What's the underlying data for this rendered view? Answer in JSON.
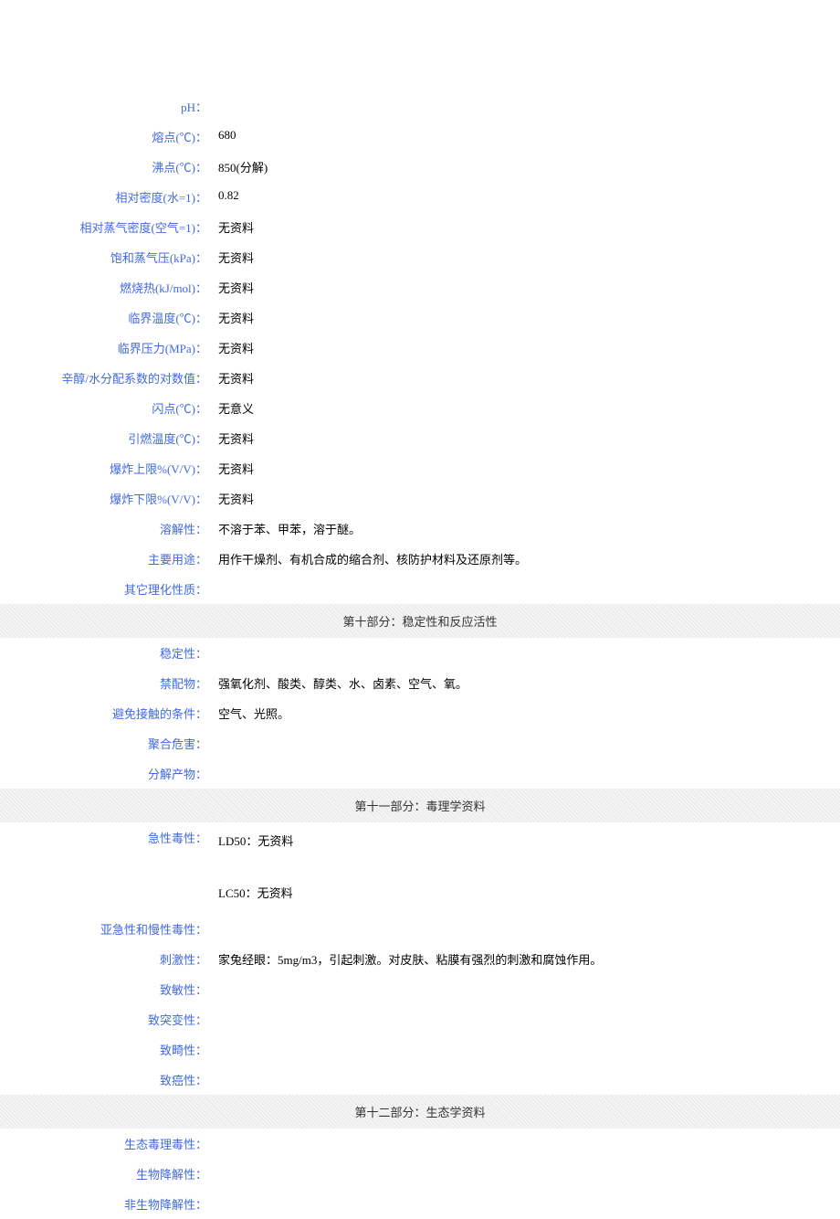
{
  "props": [
    {
      "label": "pH：",
      "value": ""
    },
    {
      "label": "熔点(℃)：",
      "value": "680"
    },
    {
      "label": "沸点(℃)：",
      "value": "850(分解)"
    },
    {
      "label": "相对密度(水=1)：",
      "value": "0.82"
    },
    {
      "label": "相对蒸气密度(空气=1)：",
      "value": "无资料"
    },
    {
      "label": "饱和蒸气压(kPa)：",
      "value": "无资料"
    },
    {
      "label": "燃烧热(kJ/mol)：",
      "value": "无资料"
    },
    {
      "label": "临界温度(℃)：",
      "value": "无资料"
    },
    {
      "label": "临界压力(MPa)：",
      "value": "无资料"
    },
    {
      "label": "辛醇/水分配系数的对数值：",
      "value": "无资料"
    },
    {
      "label": "闪点(℃)：",
      "value": "无意义"
    },
    {
      "label": "引燃温度(℃)：",
      "value": "无资料"
    },
    {
      "label": "爆炸上限%(V/V)：",
      "value": "无资料"
    },
    {
      "label": "爆炸下限%(V/V)：",
      "value": "无资料"
    },
    {
      "label": "溶解性：",
      "value": "不溶于苯、甲苯，溶于醚。"
    },
    {
      "label": "主要用途：",
      "value": "用作干燥剂、有机合成的缩合剂、核防护材料及还原剂等。"
    },
    {
      "label": "其它理化性质：",
      "value": ""
    }
  ],
  "section10": {
    "title": "第十部分：稳定性和反应活性",
    "rows": [
      {
        "label": "稳定性：",
        "value": ""
      },
      {
        "label": "禁配物：",
        "value": "强氧化剂、酸类、醇类、水、卤素、空气、氧。"
      },
      {
        "label": "避免接触的条件：",
        "value": "空气、光照。"
      },
      {
        "label": "聚合危害：",
        "value": ""
      },
      {
        "label": "分解产物：",
        "value": ""
      }
    ]
  },
  "section11": {
    "title": "第十一部分：毒理学资料",
    "rows": [
      {
        "label": "急性毒性：",
        "value": "LD50：无资料\n\nLC50：无资料",
        "multi": true
      },
      {
        "label": "亚急性和慢性毒性：",
        "value": ""
      },
      {
        "label": "刺激性：",
        "value": "家兔经眼：5mg/m3，引起刺激。对皮肤、粘膜有强烈的刺激和腐蚀作用。"
      },
      {
        "label": "致敏性：",
        "value": ""
      },
      {
        "label": "致突变性：",
        "value": ""
      },
      {
        "label": "致畸性：",
        "value": ""
      },
      {
        "label": "致癌性：",
        "value": ""
      }
    ]
  },
  "section12": {
    "title": "第十二部分：生态学资料",
    "rows": [
      {
        "label": "生态毒理毒性：",
        "value": ""
      },
      {
        "label": "生物降解性：",
        "value": ""
      },
      {
        "label": "非生物降解性：",
        "value": ""
      }
    ]
  }
}
